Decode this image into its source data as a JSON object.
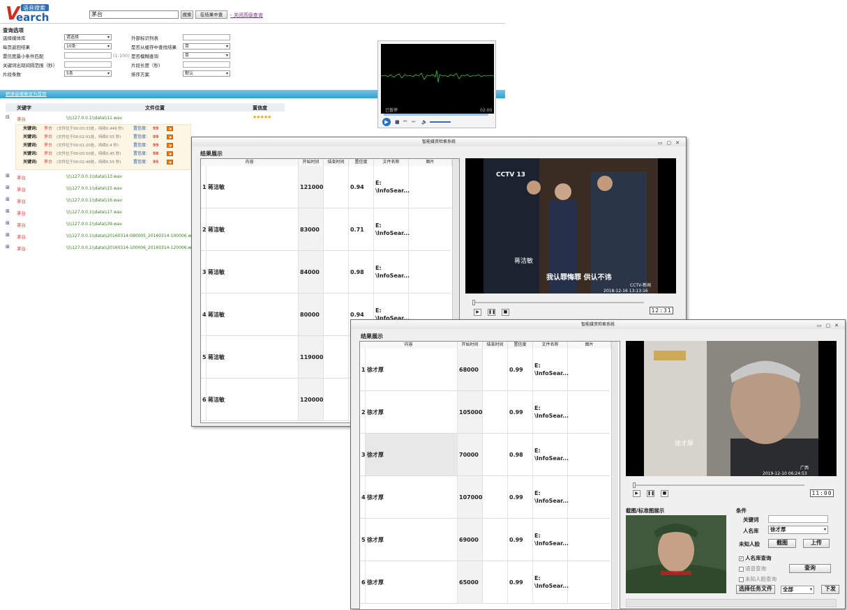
{
  "search_page": {
    "logo": {
      "text_top": "语音搜索",
      "text_main": "Search",
      "letter": "V"
    },
    "search": {
      "value": "茅台",
      "search_button": "搜索",
      "in_results_button": "在结果中查",
      "advanced_close": "- 关闭高级查询"
    },
    "options_title": "查询选项",
    "options": [
      {
        "label": "选择媒体库",
        "value": "请选择"
      },
      {
        "label": "每页返回结果",
        "value": "10条"
      },
      {
        "label": "置信度最小条件匹配",
        "value": "",
        "hint": "(1-100)"
      },
      {
        "label": "关键词出现间隔范围（秒）",
        "value": ""
      },
      {
        "label": "片段条数",
        "value": "5条"
      }
    ],
    "options_right": [
      {
        "label": "外部标识列表",
        "value": ""
      },
      {
        "label": "是否从缓存中查找结果",
        "value": "否"
      },
      {
        "label": "是否模糊查询",
        "value": "否"
      },
      {
        "label": "片段长度（秒）",
        "value": ""
      },
      {
        "label": "排序方案",
        "value": "默认"
      }
    ],
    "set_home_link": "把语音搜索设为首页",
    "results_columns": [
      "关键字",
      "文件位置",
      "置信度"
    ],
    "first_result": {
      "keyword": "茅台",
      "path": "\\\\\\\\127.0.0.1\\\\data\\\\11.wav",
      "stars": "★★★★★"
    },
    "sub_results": [
      {
        "label": "关键词:",
        "kw": "茅台",
        "detail": "(文件位于00:00:33处，持续0.449 秒)",
        "conf_label": "置信度:",
        "conf": "99"
      },
      {
        "label": "关键词:",
        "kw": "茅台",
        "detail": "(文件位于00:02:01处，持续0.55 秒)",
        "conf_label": "置信度:",
        "conf": "99"
      },
      {
        "label": "关键词:",
        "kw": "茅台",
        "detail": "(文件位于00:01:20处，持续0.4 秒)",
        "conf_label": "置信度:",
        "conf": "99"
      },
      {
        "label": "关键词:",
        "kw": "茅台",
        "detail": "(文件位于00:00:50处，持续0.45 秒)",
        "conf_label": "置信度:",
        "conf": "98"
      },
      {
        "label": "关键词:",
        "kw": "茅台",
        "detail": "(文件位于00:02:48处，持续0.55 秒)",
        "conf_label": "置信度:",
        "conf": "95"
      }
    ],
    "more_results": [
      {
        "kw": "茅台",
        "path": "\\\\\\\\127.0.0.1\\\\data\\\\13.wav"
      },
      {
        "kw": "茅台",
        "path": "\\\\\\\\127.0.0.1\\\\data\\\\15.wav"
      },
      {
        "kw": "茅台",
        "path": "\\\\\\\\127.0.0.1\\\\data\\\\16.wav"
      },
      {
        "kw": "茅台",
        "path": "\\\\\\\\127.0.0.1\\\\data\\\\17.wav"
      },
      {
        "kw": "茅台",
        "path": "\\\\\\\\127.0.0.1\\\\data\\\\39.wav"
      },
      {
        "kw": "茅台",
        "path": "\\\\\\\\127.0.0.1\\\\data\\\\20160314-080005_20160314-100006.wa"
      },
      {
        "kw": "茅台",
        "path": "\\\\\\\\127.0.0.1\\\\data\\\\20160314-100006_20160314-120006.wa"
      }
    ],
    "audio": {
      "status": "已暂停",
      "time": "02:00"
    }
  },
  "window1": {
    "title": "智能媒资检索系统",
    "section": "结果展示",
    "columns": [
      "内容",
      "开始时间",
      "结束时间",
      "置信度",
      "文件名称",
      "图片"
    ],
    "rows": [
      {
        "n": "1",
        "name": "蒋洁敏",
        "start": "121000",
        "end": "",
        "conf": "0.94",
        "file1": "E:",
        "file2": "\\InfoSear..."
      },
      {
        "n": "2",
        "name": "蒋洁敏",
        "start": "83000",
        "end": "",
        "conf": "0.71",
        "file1": "E:",
        "file2": "\\InfoSear..."
      },
      {
        "n": "3",
        "name": "蒋洁敏",
        "start": "84000",
        "end": "",
        "conf": "0.98",
        "file1": "E:",
        "file2": "\\InfoSear..."
      },
      {
        "n": "4",
        "name": "蒋洁敏",
        "start": "80000",
        "end": "",
        "conf": "0.94",
        "file1": "E:",
        "file2": "\\InfoSear..."
      },
      {
        "n": "5",
        "name": "蒋洁敏",
        "start": "119000",
        "end": "",
        "conf": "",
        "file1": "",
        "file2": ""
      },
      {
        "n": "6",
        "name": "蒋洁敏",
        "start": "120000",
        "end": "",
        "conf": "",
        "file1": "",
        "file2": ""
      }
    ],
    "video": {
      "channel": "CCTV 13",
      "caption_name": "蒋洁敏",
      "caption": "我认罪悔罪 供认不讳",
      "stamp": "CCTV-新闻",
      "date": "2018-12-16 13:13:16",
      "counter": "12:31"
    }
  },
  "window2": {
    "title": "智能媒资检索系统",
    "section": "结果展示",
    "columns": [
      "内容",
      "开始时间",
      "结束时间",
      "置信度",
      "文件名称",
      "图片"
    ],
    "rows": [
      {
        "n": "1",
        "name": "徐才厚",
        "start": "68000",
        "end": "",
        "conf": "0.99",
        "file1": "E:",
        "file2": "\\InfoSear..."
      },
      {
        "n": "2",
        "name": "徐才厚",
        "start": "105000",
        "end": "",
        "conf": "0.99",
        "file1": "E:",
        "file2": "\\InfoSear..."
      },
      {
        "n": "3",
        "name": "徐才厚",
        "start": "70000",
        "end": "",
        "conf": "0.98",
        "file1": "E:",
        "file2": "\\InfoSear..."
      },
      {
        "n": "4",
        "name": "徐才厚",
        "start": "107000",
        "end": "",
        "conf": "0.99",
        "file1": "E:",
        "file2": "\\InfoSear..."
      },
      {
        "n": "5",
        "name": "徐才厚",
        "start": "69000",
        "end": "",
        "conf": "0.99",
        "file1": "E:",
        "file2": "\\InfoSear..."
      },
      {
        "n": "6",
        "name": "徐才厚",
        "start": "65000",
        "end": "",
        "conf": "0.99",
        "file1": "E:",
        "file2": "\\InfoSear..."
      }
    ],
    "video": {
      "caption_name": "徐才厚",
      "stamp": "广西",
      "date": "2019-12-10 06:24:53",
      "counter": "11:00"
    },
    "capture_title": "截图/标准图展示",
    "conditions": {
      "title": "条件",
      "keyword_label": "关键词",
      "keyword_value": "",
      "person_lib_label": "人名库",
      "person_lib_value": "徐才厚",
      "unknown_face_label": "未知人脸",
      "screenshot_btn": "截图",
      "upload_btn": "上传",
      "chk_person": "人名库查询",
      "chk_voice": "语音查询",
      "chk_unknown": "未知人脸查询",
      "query_btn": "查询",
      "select_task_btn": "选择任务文件",
      "scope_value": "全部",
      "dispatch_btn": "下发"
    }
  },
  "colors": {
    "accent_blue": "#3a9fd0",
    "keyword_red": "#d44",
    "path_green": "#3b7d1e",
    "star": "#f0a000"
  }
}
